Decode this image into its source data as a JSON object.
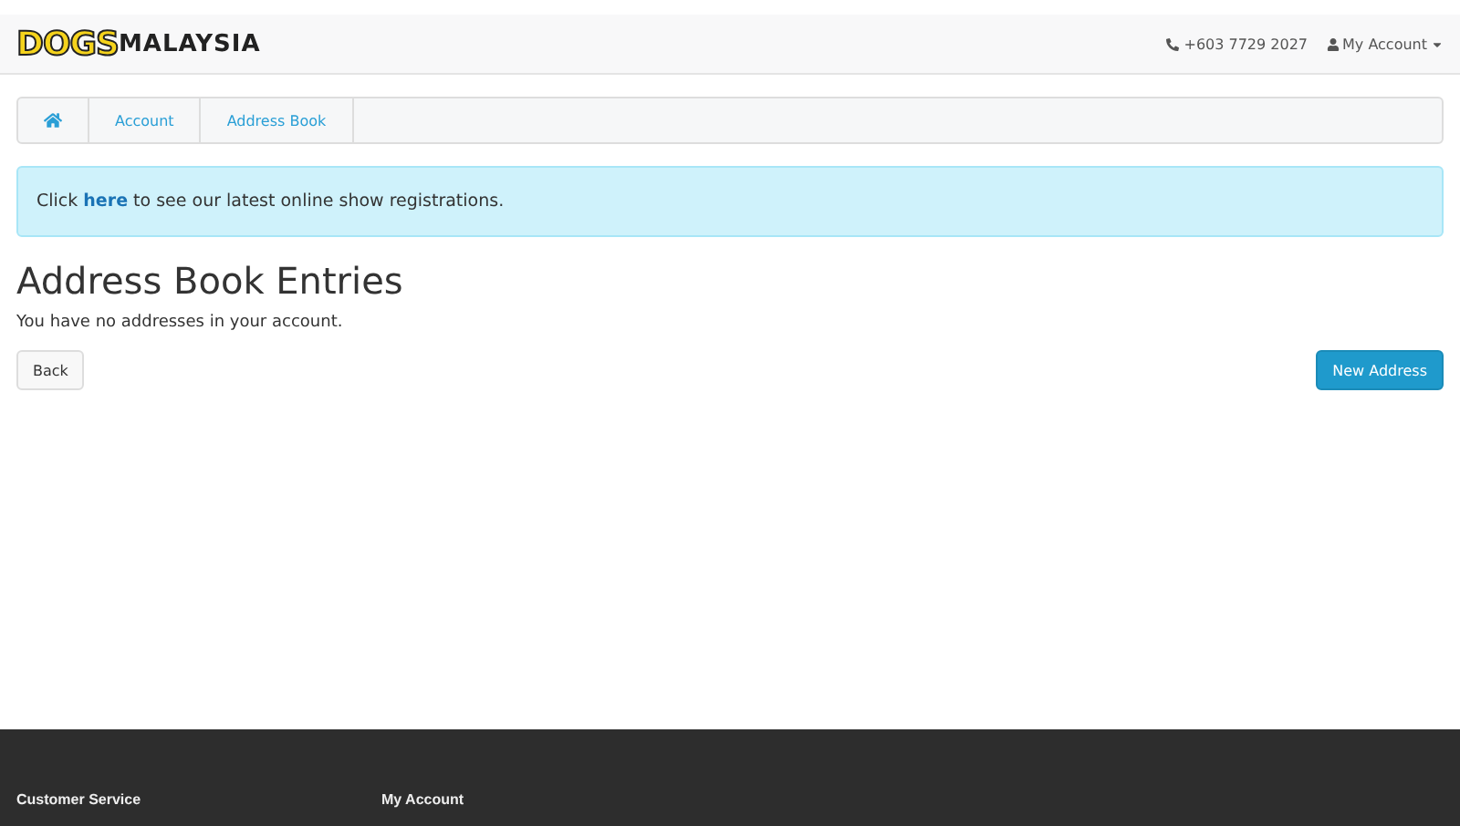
{
  "header": {
    "logo": {
      "accent": "DOGS",
      "rest": "MALAYSIA"
    },
    "phone": "+603 7729 2027",
    "account_menu": "My Account"
  },
  "breadcrumb": [
    {
      "kind": "home"
    },
    {
      "kind": "text",
      "label": "Account"
    },
    {
      "kind": "text",
      "label": "Address Book"
    }
  ],
  "alert": {
    "before": "Click",
    "link": "here",
    "after": "to see our latest online show registrations."
  },
  "title": "Address Book Entries",
  "message": "You have no addresses in your account.",
  "buttons": [
    {
      "label": "Back",
      "kind": "default"
    },
    {
      "label": "New Address",
      "kind": "primary"
    }
  ],
  "footer": {
    "columns": [
      "Customer Service",
      "My Account"
    ]
  }
}
